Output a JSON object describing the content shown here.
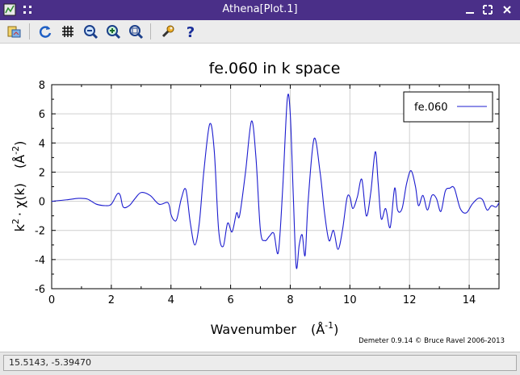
{
  "window": {
    "title": "Athena[Plot.1]",
    "app_icon": "athena-app-icon",
    "menu_icon": "window-menu-icon",
    "controls": [
      "minimize-icon",
      "maximize-icon",
      "close-icon"
    ]
  },
  "toolbar": {
    "buttons": [
      {
        "icon": "open-file-icon",
        "tooltip": ""
      },
      {
        "icon": "refresh-icon",
        "tooltip": ""
      },
      {
        "icon": "grid-icon",
        "tooltip": ""
      },
      {
        "icon": "zoom-out-icon",
        "tooltip": ""
      },
      {
        "icon": "zoom-in-icon",
        "tooltip": ""
      },
      {
        "icon": "zoom-fit-icon",
        "tooltip": ""
      },
      {
        "icon": "settings-wrench-icon",
        "tooltip": ""
      },
      {
        "icon": "help-icon",
        "tooltip": ""
      }
    ]
  },
  "plot": {
    "credit": "Demeter 0.9.14 © Bruce Ravel 2006-2013"
  },
  "chart_data": {
    "type": "line",
    "title": "fe.060 in k space",
    "xlabel": "Wavenumber",
    "xunit": "(Å",
    "xunit_exp": "-1",
    "ylabel": "k",
    "ylabel_exp": "2",
    "ylabel_rest": "· χ(k)",
    "yunit": "(Å",
    "yunit_exp": "-2",
    "xlim": [
      0,
      15
    ],
    "ylim": [
      -6,
      8
    ],
    "xticks": [
      "0",
      "2",
      "4",
      "6",
      "8",
      "10",
      "12",
      "14"
    ],
    "yticks": [
      "8",
      "6",
      "4",
      "2",
      "0",
      "-2",
      "-4",
      "-6"
    ],
    "grid": true,
    "legend_position": "top-right",
    "series": [
      {
        "name": "fe.060",
        "color": "#1c1ccf",
        "x": [
          0,
          0.5,
          0.9,
          1.2,
          1.5,
          1.8,
          2.0,
          2.2,
          2.3,
          2.4,
          2.6,
          2.8,
          3.0,
          3.3,
          3.6,
          3.9,
          4.0,
          4.1,
          4.2,
          4.35,
          4.5,
          4.65,
          4.8,
          4.95,
          5.1,
          5.3,
          5.45,
          5.6,
          5.75,
          5.9,
          6.05,
          6.2,
          6.3,
          6.5,
          6.7,
          6.85,
          7.0,
          7.15,
          7.3,
          7.45,
          7.6,
          7.75,
          7.9,
          8.0,
          8.1,
          8.2,
          8.3,
          8.4,
          8.5,
          8.6,
          8.8,
          9.0,
          9.15,
          9.3,
          9.45,
          9.6,
          9.75,
          9.9,
          10.0,
          10.1,
          10.25,
          10.4,
          10.55,
          10.7,
          10.85,
          10.95,
          11.05,
          11.2,
          11.35,
          11.5,
          11.6,
          11.75,
          11.9,
          12.05,
          12.2,
          12.3,
          12.45,
          12.6,
          12.75,
          12.9,
          13.05,
          13.2,
          13.35,
          13.5,
          13.7,
          13.9,
          14.1,
          14.3,
          14.45,
          14.6,
          14.75,
          14.9,
          15.0
        ],
        "y": [
          0,
          0.1,
          0.2,
          0.15,
          -0.2,
          -0.3,
          -0.2,
          0.5,
          0.4,
          -0.4,
          -0.3,
          0.2,
          0.6,
          0.4,
          -0.2,
          -0.1,
          -0.9,
          -1.3,
          -1.2,
          0.2,
          0.8,
          -1.5,
          -3.0,
          -1.5,
          2.0,
          5.3,
          3.5,
          -2.0,
          -3.1,
          -1.5,
          -2.1,
          -0.8,
          -1.0,
          2.0,
          5.5,
          3.0,
          -2.0,
          -2.7,
          -2.4,
          -2.2,
          -3.5,
          1.0,
          7.0,
          6.0,
          0.5,
          -4.5,
          -3.0,
          -2.3,
          -3.7,
          0.0,
          4.3,
          2.0,
          -0.8,
          -2.7,
          -2.0,
          -3.3,
          -2.0,
          0.2,
          0.3,
          -0.5,
          0.3,
          1.5,
          -1.0,
          0.6,
          3.4,
          1.2,
          -1.2,
          -0.5,
          -1.8,
          0.9,
          -0.6,
          -0.5,
          1.2,
          2.1,
          1.0,
          -0.3,
          0.4,
          -0.6,
          0.4,
          0.2,
          -0.7,
          0.7,
          0.9,
          0.9,
          -0.5,
          -0.8,
          -0.2,
          0.2,
          0.1,
          -0.6,
          -0.3,
          -0.4,
          -0.1
        ]
      }
    ]
  },
  "status": {
    "coordinates": "15.5143, -5.39470"
  }
}
